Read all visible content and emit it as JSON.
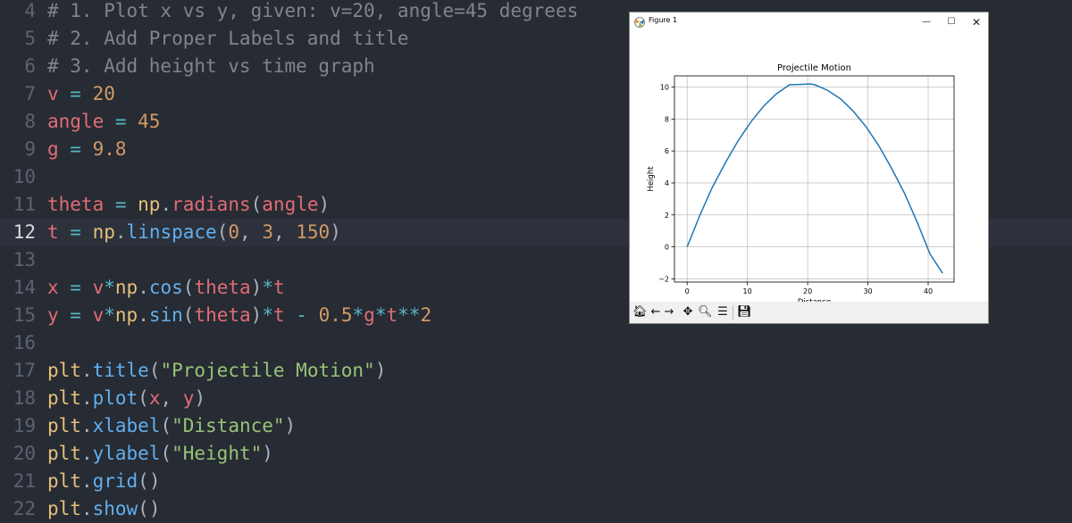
{
  "editor": {
    "current_line": "12",
    "lines": [
      {
        "num": "4",
        "tokens": [
          {
            "t": "# 1. Plot x vs y, given: v=20, angle=45 degrees",
            "c": "comment"
          }
        ]
      },
      {
        "num": "5",
        "tokens": [
          {
            "t": "# 2. Add Proper Labels and title",
            "c": "comment"
          }
        ]
      },
      {
        "num": "6",
        "tokens": [
          {
            "t": "# 3. Add height vs time graph",
            "c": "comment"
          }
        ]
      },
      {
        "num": "7",
        "tokens": [
          {
            "t": "v",
            "c": "var"
          },
          {
            "t": " = ",
            "c": "op"
          },
          {
            "t": "20",
            "c": "num"
          }
        ]
      },
      {
        "num": "8",
        "tokens": [
          {
            "t": "angle",
            "c": "var"
          },
          {
            "t": " = ",
            "c": "op"
          },
          {
            "t": "45",
            "c": "num"
          }
        ]
      },
      {
        "num": "9",
        "tokens": [
          {
            "t": "g",
            "c": "var"
          },
          {
            "t": " = ",
            "c": "op"
          },
          {
            "t": "9.8",
            "c": "num"
          }
        ]
      },
      {
        "num": "10",
        "tokens": []
      },
      {
        "num": "11",
        "tokens": [
          {
            "t": "theta",
            "c": "var"
          },
          {
            "t": " = ",
            "c": "op"
          },
          {
            "t": "np",
            "c": "mod"
          },
          {
            "t": ".",
            "c": "plain"
          },
          {
            "t": "radians",
            "c": "var"
          },
          {
            "t": "(",
            "c": "plain"
          },
          {
            "t": "angle",
            "c": "var"
          },
          {
            "t": ")",
            "c": "plain"
          }
        ]
      },
      {
        "num": "12",
        "tokens": [
          {
            "t": "t",
            "c": "var"
          },
          {
            "t": " = ",
            "c": "op"
          },
          {
            "t": "np",
            "c": "mod"
          },
          {
            "t": ".",
            "c": "plain"
          },
          {
            "t": "linspace",
            "c": "func"
          },
          {
            "t": "(",
            "c": "plain"
          },
          {
            "t": "0",
            "c": "num"
          },
          {
            "t": ", ",
            "c": "plain"
          },
          {
            "t": "3",
            "c": "num"
          },
          {
            "t": ", ",
            "c": "plain"
          },
          {
            "t": "150",
            "c": "num"
          },
          {
            "t": ")",
            "c": "plain"
          }
        ]
      },
      {
        "num": "13",
        "tokens": []
      },
      {
        "num": "14",
        "tokens": [
          {
            "t": "x",
            "c": "var"
          },
          {
            "t": " = ",
            "c": "op"
          },
          {
            "t": "v",
            "c": "var"
          },
          {
            "t": "*",
            "c": "op"
          },
          {
            "t": "np",
            "c": "mod"
          },
          {
            "t": ".",
            "c": "plain"
          },
          {
            "t": "cos",
            "c": "func"
          },
          {
            "t": "(",
            "c": "plain"
          },
          {
            "t": "theta",
            "c": "var"
          },
          {
            "t": ")",
            "c": "plain"
          },
          {
            "t": "*",
            "c": "op"
          },
          {
            "t": "t",
            "c": "var"
          }
        ]
      },
      {
        "num": "15",
        "tokens": [
          {
            "t": "y",
            "c": "var"
          },
          {
            "t": " = ",
            "c": "op"
          },
          {
            "t": "v",
            "c": "var"
          },
          {
            "t": "*",
            "c": "op"
          },
          {
            "t": "np",
            "c": "mod"
          },
          {
            "t": ".",
            "c": "plain"
          },
          {
            "t": "sin",
            "c": "func"
          },
          {
            "t": "(",
            "c": "plain"
          },
          {
            "t": "theta",
            "c": "var"
          },
          {
            "t": ")",
            "c": "plain"
          },
          {
            "t": "*",
            "c": "op"
          },
          {
            "t": "t",
            "c": "var"
          },
          {
            "t": " - ",
            "c": "op"
          },
          {
            "t": "0.5",
            "c": "num"
          },
          {
            "t": "*",
            "c": "op"
          },
          {
            "t": "g",
            "c": "var"
          },
          {
            "t": "*",
            "c": "op"
          },
          {
            "t": "t",
            "c": "var"
          },
          {
            "t": "**",
            "c": "op"
          },
          {
            "t": "2",
            "c": "num"
          }
        ]
      },
      {
        "num": "16",
        "tokens": []
      },
      {
        "num": "17",
        "tokens": [
          {
            "t": "plt",
            "c": "mod"
          },
          {
            "t": ".",
            "c": "plain"
          },
          {
            "t": "title",
            "c": "func"
          },
          {
            "t": "(",
            "c": "plain"
          },
          {
            "t": "\"Projectile Motion\"",
            "c": "str"
          },
          {
            "t": ")",
            "c": "plain"
          }
        ]
      },
      {
        "num": "18",
        "tokens": [
          {
            "t": "plt",
            "c": "mod"
          },
          {
            "t": ".",
            "c": "plain"
          },
          {
            "t": "plot",
            "c": "func"
          },
          {
            "t": "(",
            "c": "plain"
          },
          {
            "t": "x",
            "c": "var"
          },
          {
            "t": ", ",
            "c": "plain"
          },
          {
            "t": "y",
            "c": "var"
          },
          {
            "t": ")",
            "c": "plain"
          }
        ]
      },
      {
        "num": "19",
        "tokens": [
          {
            "t": "plt",
            "c": "mod"
          },
          {
            "t": ".",
            "c": "plain"
          },
          {
            "t": "xlabel",
            "c": "func"
          },
          {
            "t": "(",
            "c": "plain"
          },
          {
            "t": "\"Distance\"",
            "c": "str"
          },
          {
            "t": ")",
            "c": "plain"
          }
        ]
      },
      {
        "num": "20",
        "tokens": [
          {
            "t": "plt",
            "c": "mod"
          },
          {
            "t": ".",
            "c": "plain"
          },
          {
            "t": "ylabel",
            "c": "func"
          },
          {
            "t": "(",
            "c": "plain"
          },
          {
            "t": "\"Height\"",
            "c": "str"
          },
          {
            "t": ")",
            "c": "plain"
          }
        ]
      },
      {
        "num": "21",
        "tokens": [
          {
            "t": "plt",
            "c": "mod"
          },
          {
            "t": ".",
            "c": "plain"
          },
          {
            "t": "grid",
            "c": "func"
          },
          {
            "t": "()",
            "c": "plain"
          }
        ]
      },
      {
        "num": "22",
        "tokens": [
          {
            "t": "plt",
            "c": "mod"
          },
          {
            "t": ".",
            "c": "plain"
          },
          {
            "t": "show",
            "c": "func"
          },
          {
            "t": "()",
            "c": "plain"
          }
        ]
      }
    ]
  },
  "colors": {
    "comment": "#7f848e",
    "var": "#e06c75",
    "op": "#56b6c2",
    "num": "#d19a66",
    "str": "#98c379",
    "func": "#61afef",
    "mod": "#e5c07b",
    "plain": "#abb2bf",
    "line_color": "#1f77b4"
  },
  "window": {
    "title": "Figure 1",
    "minimize_icon": "minimize-icon",
    "maximize_icon": "maximize-icon",
    "close_icon": "close-icon"
  },
  "toolbar": {
    "tools": [
      {
        "name": "home-icon",
        "glyph": "🏠︎"
      },
      {
        "name": "back-icon",
        "glyph": "←"
      },
      {
        "name": "forward-icon",
        "glyph": "→"
      },
      {
        "name": "pan-icon",
        "glyph": "✥"
      },
      {
        "name": "zoom-icon",
        "glyph": "🔍︎"
      },
      {
        "name": "configure-subplots-icon",
        "glyph": "☰"
      },
      {
        "name": "save-icon",
        "glyph": "💾︎"
      }
    ]
  },
  "chart_data": {
    "type": "line",
    "title": "Projectile Motion",
    "xlabel": "Distance",
    "ylabel": "Height",
    "xlim": [
      -2.1,
      44.3
    ],
    "ylim": [
      -2.2,
      10.7
    ],
    "xticks": [
      0,
      10,
      20,
      30,
      40
    ],
    "yticks": [
      -2,
      0,
      2,
      4,
      6,
      8,
      10
    ],
    "grid": true,
    "series": [
      {
        "x": [
          0,
          2.1,
          4.2,
          6.4,
          8.5,
          10.6,
          12.7,
          14.8,
          17.0,
          19.1,
          20.4,
          21.2,
          23.3,
          25.5,
          27.6,
          29.7,
          31.8,
          33.9,
          36.1,
          38.2,
          40.3,
          42.4
        ],
        "y": [
          0,
          1.96,
          3.74,
          5.29,
          6.66,
          7.83,
          8.8,
          9.57,
          10.14,
          10.17,
          10.2,
          10.14,
          9.8,
          9.25,
          8.48,
          7.51,
          6.33,
          4.94,
          3.33,
          1.52,
          -0.44,
          -1.65
        ]
      }
    ]
  }
}
